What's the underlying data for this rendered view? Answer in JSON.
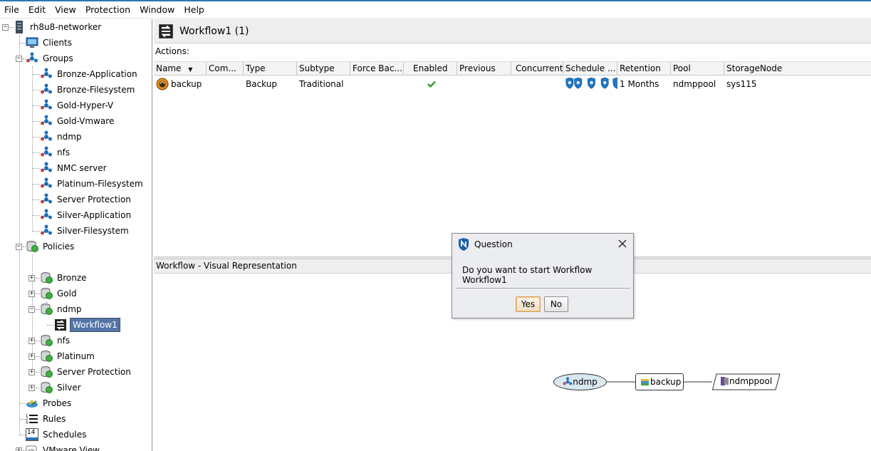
{
  "colors": {
    "accent_line": "#2b78b8",
    "selection": "#5474a8",
    "check": "#2e9d2e",
    "dialog_bg": "#ecedf1",
    "ellipse_fill": "#d9e8f1"
  },
  "menu": [
    "File",
    "Edit",
    "View",
    "Protection",
    "Window",
    "Help"
  ],
  "tree": {
    "root": "rh8u8-networker",
    "clients": "Clients",
    "groups_label": "Groups",
    "groups": [
      "Bronze-Application",
      "Bronze-Filesystem",
      "Gold-Hyper-V",
      "Gold-Vmware",
      "ndmp",
      "nfs",
      "NMC server",
      "Platinum-Filesystem",
      "Server Protection",
      "Silver-Application",
      "Silver-Filesystem"
    ],
    "policies_label": "Policies",
    "policies": [
      "Bronze",
      "Gold",
      "ndmp",
      "nfs",
      "Platinum",
      "Server Protection",
      "Silver"
    ],
    "selected_workflow": "Workflow1",
    "probes": "Probes",
    "rules": "Rules",
    "schedules": "Schedules",
    "schedules_icon_text": "14",
    "vmware_view": "VMware View",
    "icons": {
      "root": "server-icon",
      "clients": "monitor-icon",
      "group": "group-network-icon",
      "policy": "policy-database-icon",
      "workflow": "workflow-icon",
      "probes": "probe-icon",
      "rules": "rules-list-icon",
      "schedules": "calendar-icon",
      "vmware": "vm-icon"
    }
  },
  "main": {
    "title": "Workflow1 (1)",
    "actions_label": "Actions:",
    "columns": [
      "Name",
      "Com...",
      "Type",
      "Subtype",
      "Force Bac...",
      "Enabled",
      "Previous",
      "Concurrent",
      "Schedule ...",
      "Retention",
      "Pool",
      "StorageNode"
    ],
    "row": {
      "name": "backup",
      "type": "Backup",
      "subtype": "Traditional",
      "enabled": "checked",
      "retention": "1 Months",
      "pool": "ndmppool",
      "storage_node": "sys115"
    },
    "visual_title": "Workflow - Visual Representation"
  },
  "dialog": {
    "title": "Question",
    "message": "Do you want to start Workflow Workflow1",
    "yes": "Yes",
    "no": "No"
  },
  "diagram": {
    "group": "ndmp",
    "action": "backup",
    "pool": "ndmppool"
  }
}
